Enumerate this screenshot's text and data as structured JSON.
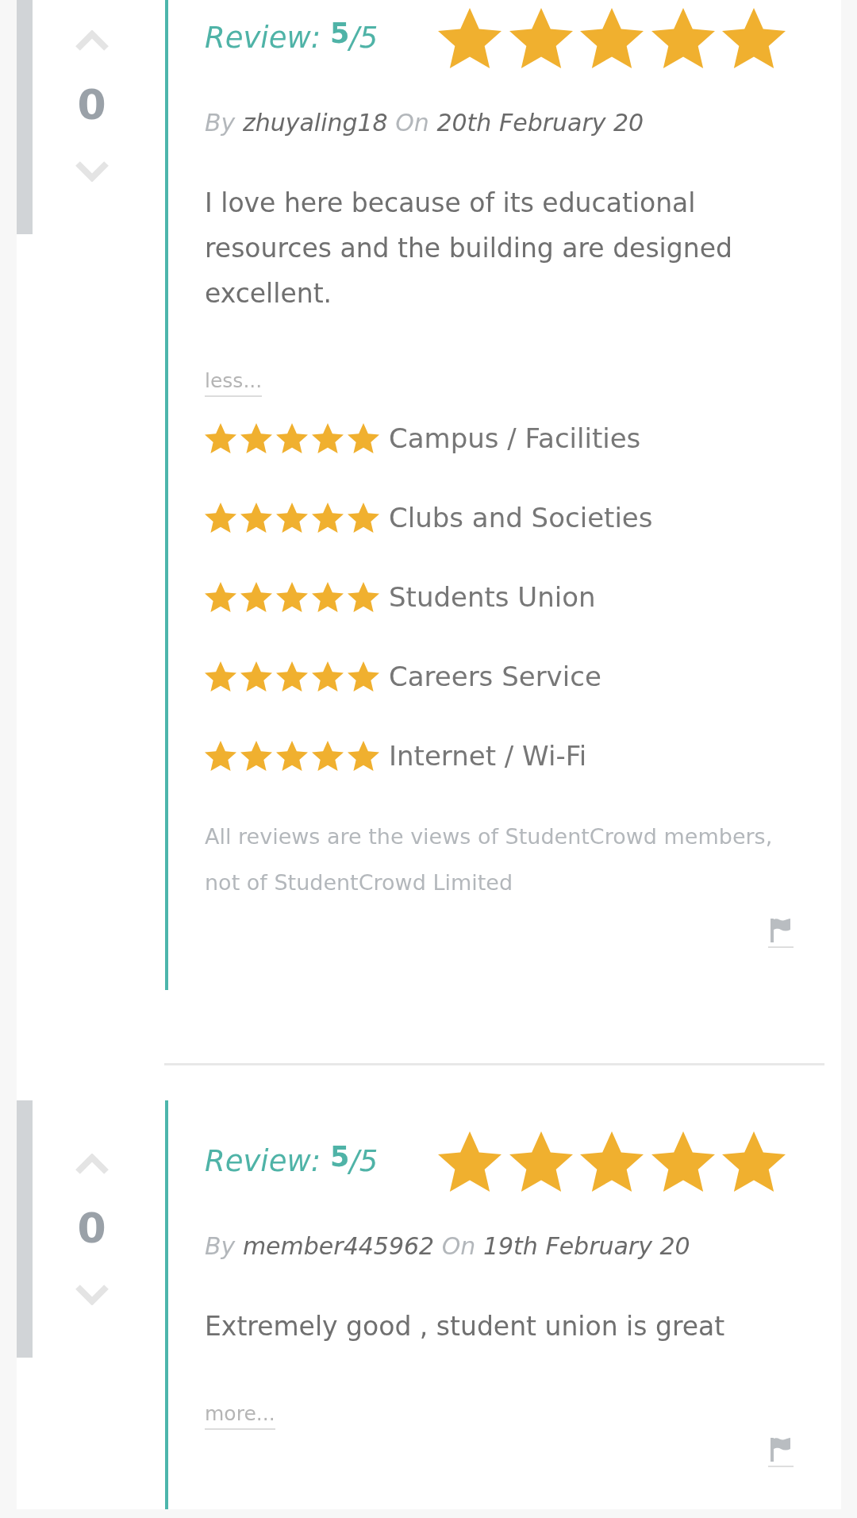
{
  "reviews": [
    {
      "votes": "0",
      "score_label": "Review:",
      "score": "5",
      "score_max": "/5",
      "stars": 5,
      "by_label": "By",
      "author": "zhuyaling18",
      "on_label": "On",
      "date": "20th February 20",
      "text": "I love here because of its educational resources and the building are designed excellent.",
      "toggle_link": "less...",
      "ratings": [
        {
          "label": "Campus / Facilities",
          "stars": 5
        },
        {
          "label": "Clubs and Societies",
          "stars": 5
        },
        {
          "label": "Students Union",
          "stars": 5
        },
        {
          "label": "Careers Service",
          "stars": 5
        },
        {
          "label": "Internet / Wi-Fi",
          "stars": 5
        }
      ],
      "disclaimer": "All reviews are the views of StudentCrowd members, not of StudentCrowd Limited"
    },
    {
      "votes": "0",
      "score_label": "Review:",
      "score": "5",
      "score_max": "/5",
      "stars": 5,
      "by_label": "By",
      "author": "member445962",
      "on_label": "On",
      "date": "19th February 20",
      "text": "Extremely good , student union is great",
      "toggle_link": "more..."
    }
  ]
}
